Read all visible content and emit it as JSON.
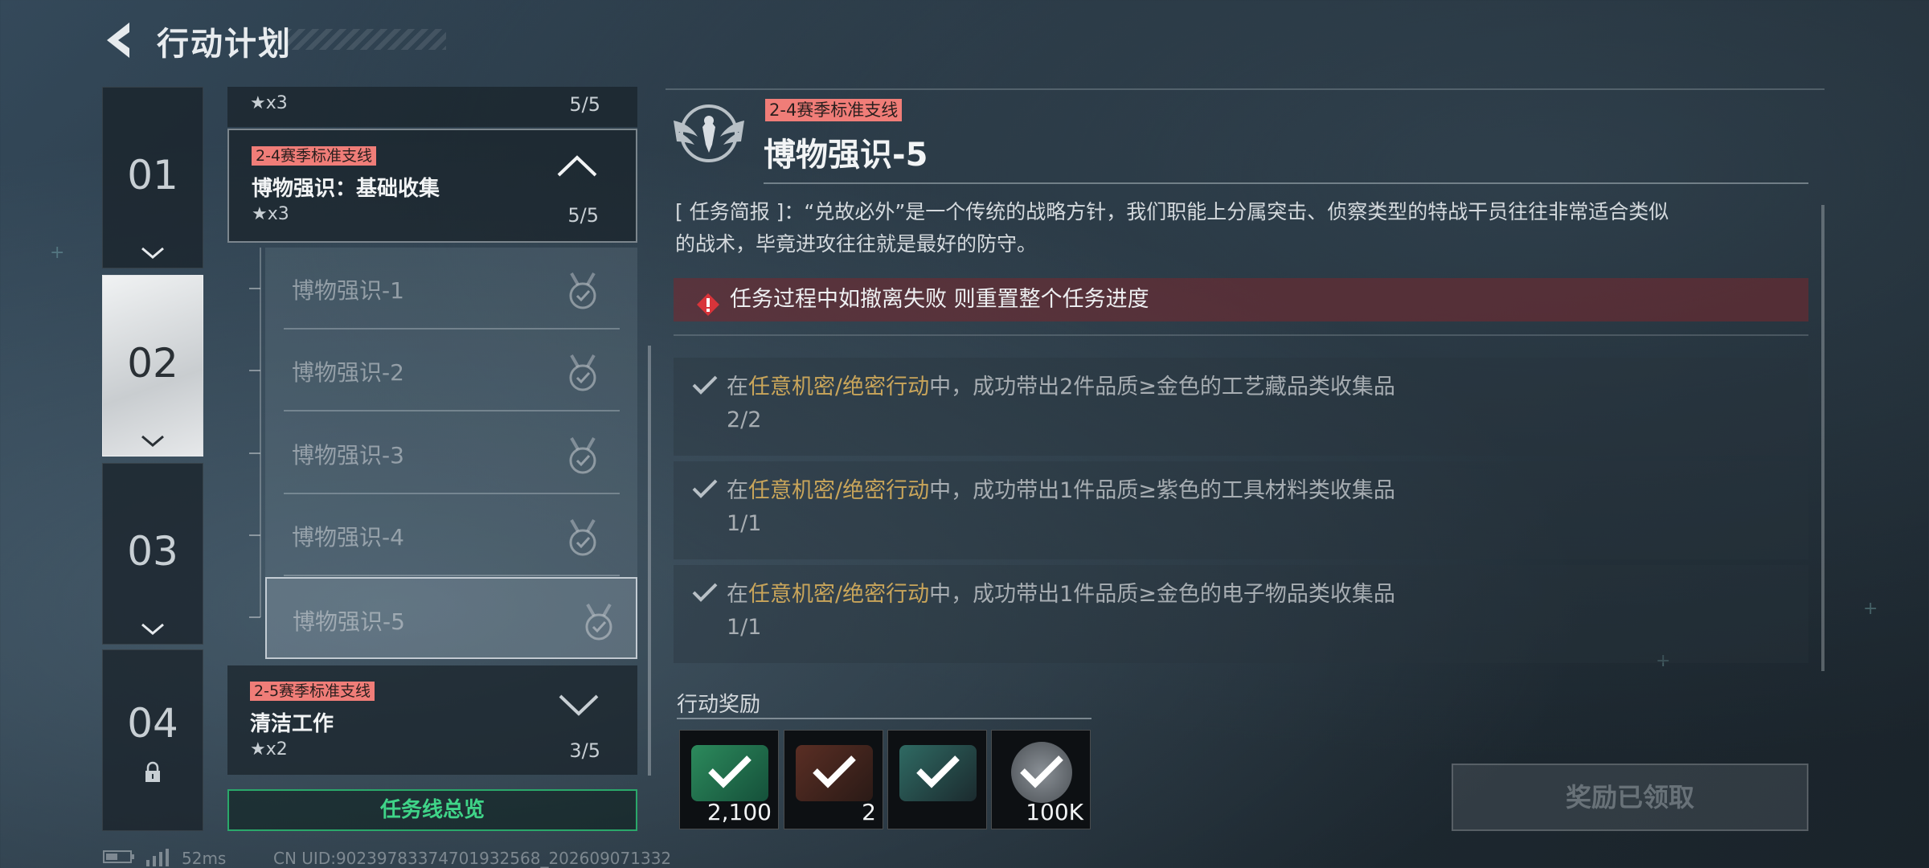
{
  "header": {
    "title": "行动计划",
    "back_icon": "back-arrow-icon"
  },
  "chapters": [
    {
      "num": "01",
      "state": "expandable"
    },
    {
      "num": "02",
      "state": "active"
    },
    {
      "num": "03",
      "state": "expandable"
    },
    {
      "num": "04",
      "state": "locked"
    }
  ],
  "quest_list": {
    "top_partial": {
      "stars": "★x3",
      "progress": "5/5"
    },
    "expanded": {
      "tag": "2-4赛季标准支线",
      "name": "博物强识：基础收集",
      "stars": "★x3",
      "progress": "5/5"
    },
    "sub_items": [
      "博物强识-1",
      "博物强识-2",
      "博物强识-3",
      "博物强识-4",
      "博物强识-5"
    ],
    "collapsed": {
      "tag": "2-5赛季标准支线",
      "name": "清洁工作",
      "stars": "★x2",
      "progress": "3/5"
    },
    "overview_button": "任务线总览"
  },
  "detail": {
    "tag": "2-4赛季标准支线",
    "title": "博物强识-5",
    "brief_line1": "[ 任务简报 ]：“兑故必外”是一个传统的战略方针，我们职能上分属突击、侦察类型的特战干员往往非常适合类似",
    "brief_line2": "的战术，毕竟进攻往往就是最好的防守。",
    "warning": "任务过程中如撤离失败 则重置整个任务进度",
    "objectives": [
      {
        "pre": "在",
        "hl": "任意机密/绝密行动",
        "post": "中，成功带出2件品质≥金色的工艺藏品类收集品",
        "count": "2/2"
      },
      {
        "pre": "在",
        "hl": "任意机密/绝密行动",
        "post": "中，成功带出1件品质≥紫色的工具材料类收集品",
        "count": "1/1"
      },
      {
        "pre": "在",
        "hl": "任意机密/绝密行动",
        "post": "中，成功带出1件品质≥金色的电子物品类收集品",
        "count": "1/1"
      }
    ],
    "reward_label": "行动奖励",
    "rewards": [
      {
        "amount": "2,100",
        "icon": "green-card-icon"
      },
      {
        "amount": "2",
        "icon": "red-crate-icon"
      },
      {
        "amount": "",
        "icon": "teal-container-icon"
      },
      {
        "amount": "100K",
        "icon": "coin-icon"
      }
    ],
    "claim_button": "奖励已领取"
  },
  "status_bar": {
    "ping": "52ms",
    "uid": "CN UID:9023978337470193256​8_202609071332"
  },
  "colors": {
    "tag_bg": "#f07d78",
    "accent_green": "#3fd488",
    "highlight_gold": "#c9a55a",
    "warning_red": "#d8343a"
  }
}
